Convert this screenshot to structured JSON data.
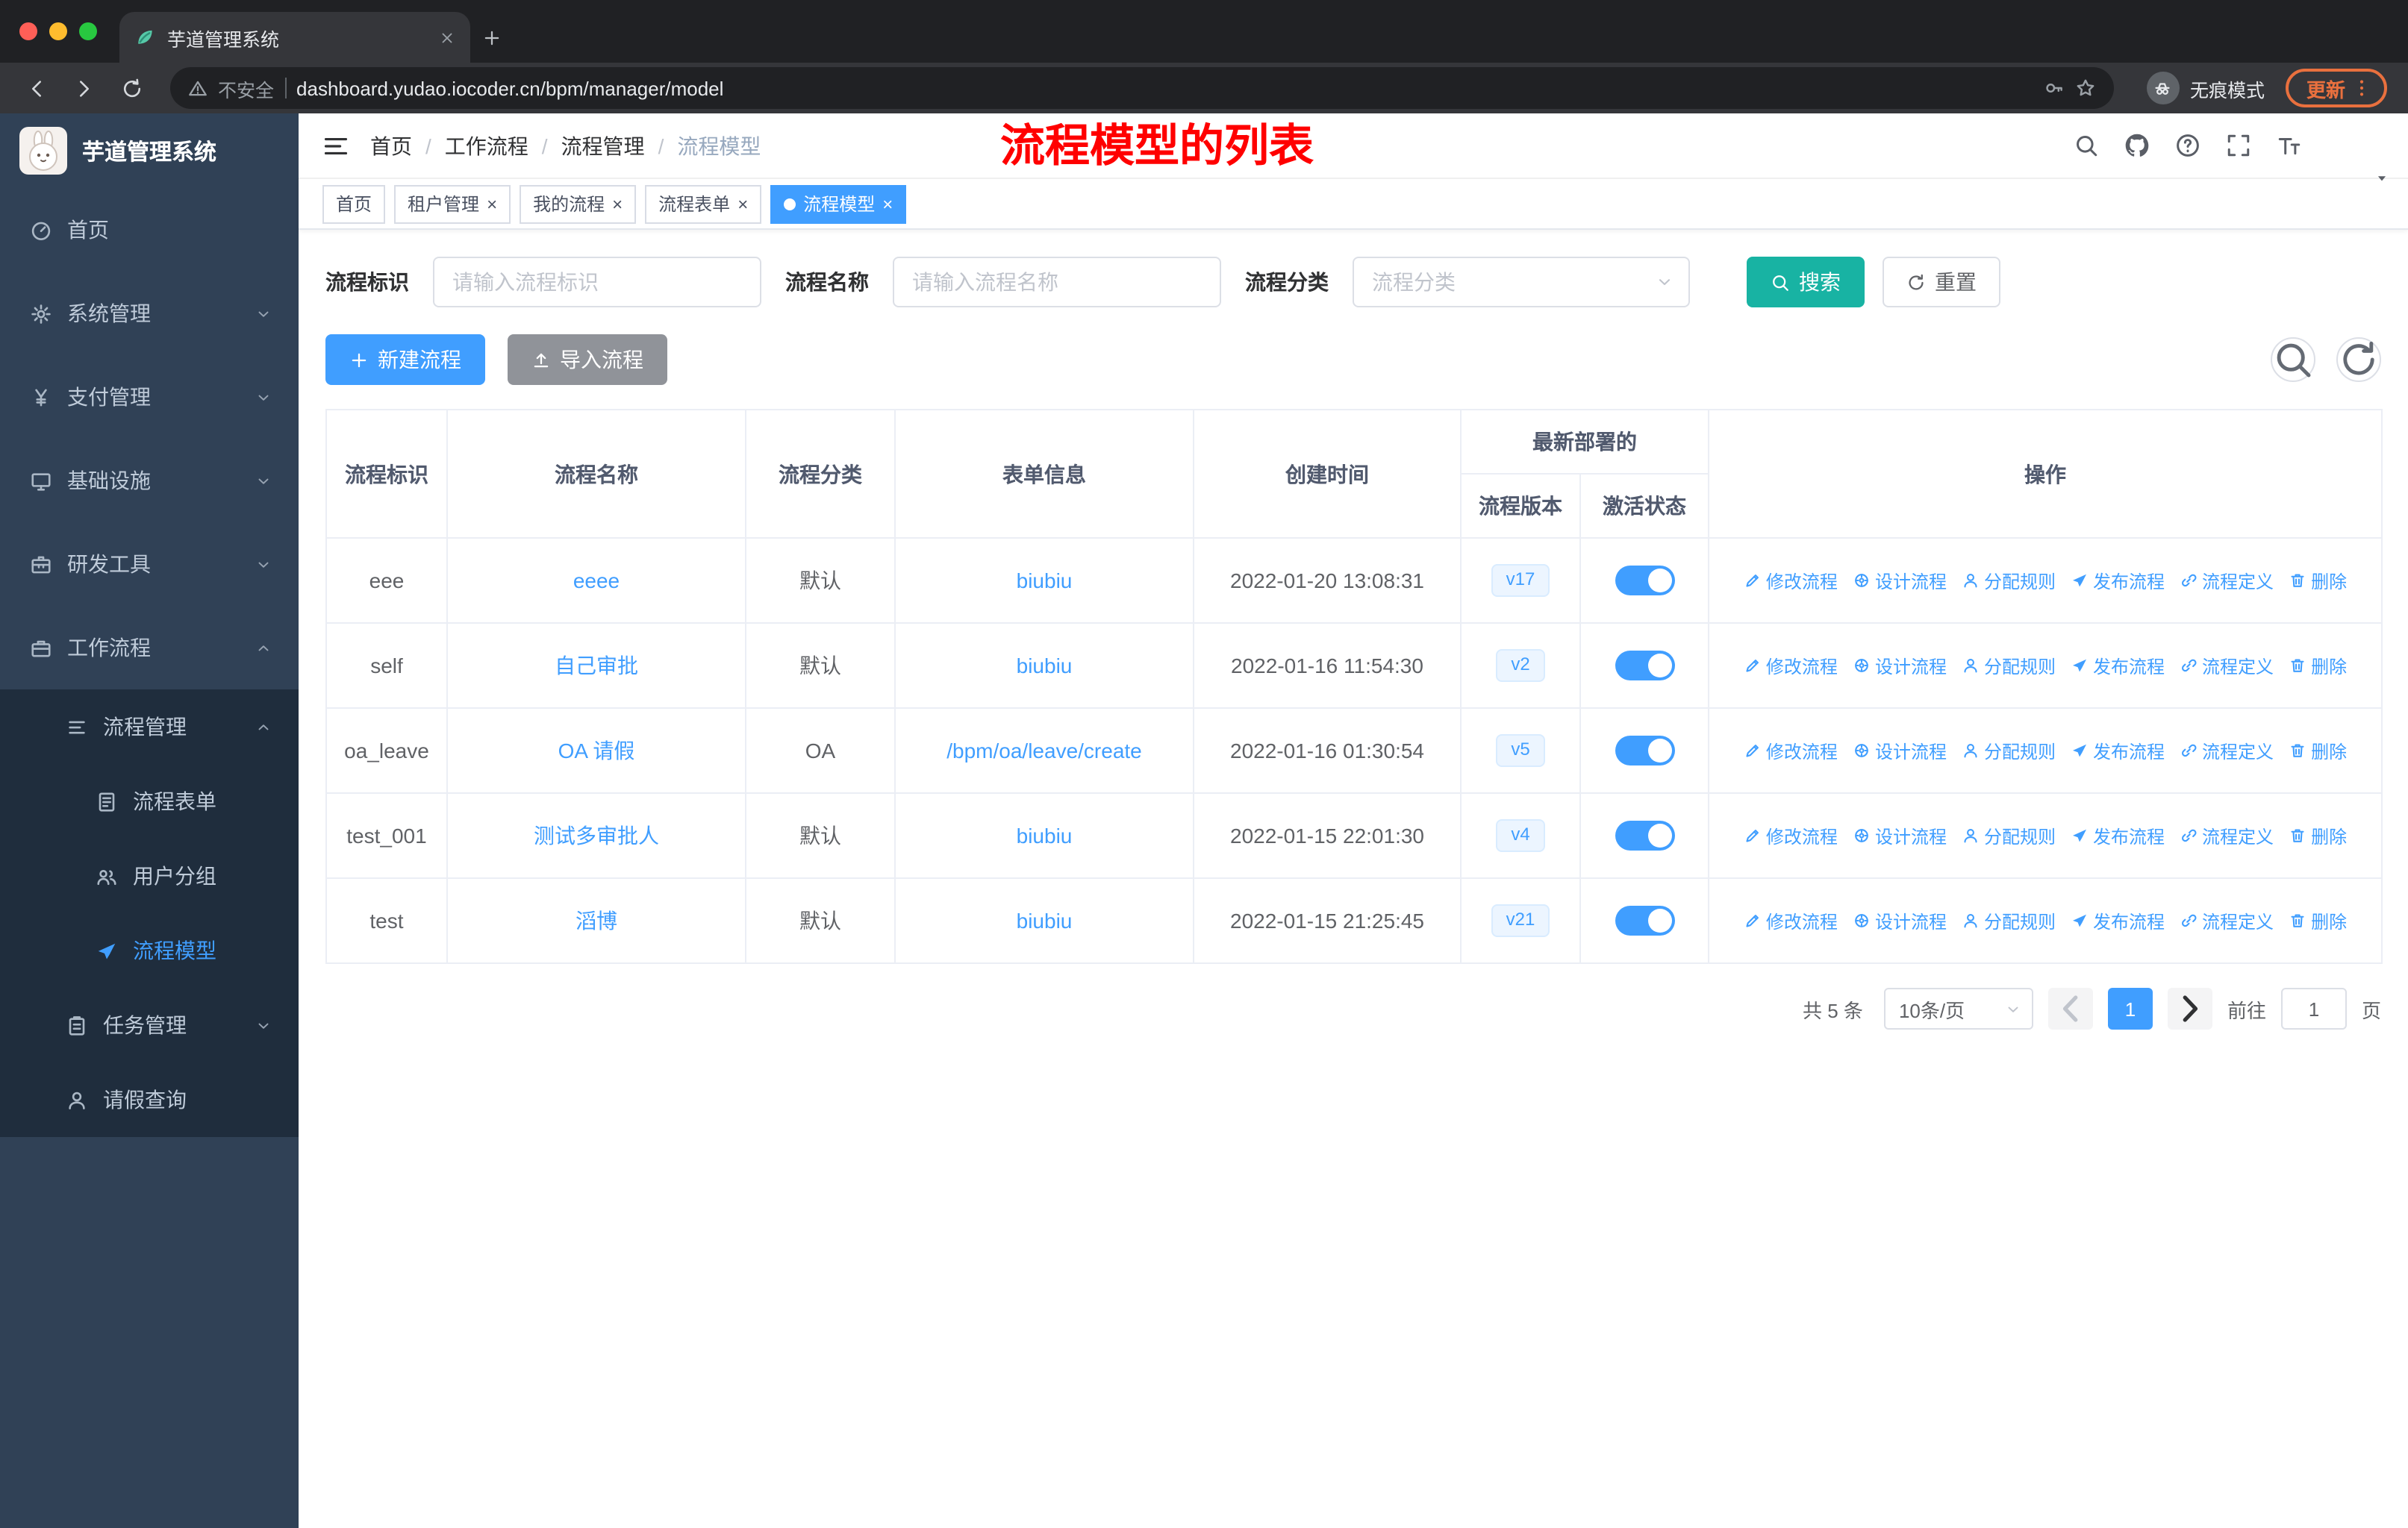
{
  "colors": {
    "accent": "#409eff",
    "search_button": "#18b3a3",
    "annotation_red": "#ff0000",
    "sidebar_bg": "#304156",
    "link": "#409eff"
  },
  "browser": {
    "tab_title": "芋道管理系统",
    "security_label": "不安全",
    "url": "dashboard.yudao.iocoder.cn/bpm/manager/model",
    "incognito_label": "无痕模式",
    "update_label": "更新"
  },
  "sidebar": {
    "logo_title": "芋道管理系统",
    "items": [
      {
        "key": "home",
        "label": "首页",
        "icon": "dashboard-icon",
        "level": 1
      },
      {
        "key": "system",
        "label": "系统管理",
        "icon": "gear-icon",
        "level": 1,
        "chevron": "down"
      },
      {
        "key": "payment",
        "label": "支付管理",
        "icon": "yen-icon",
        "level": 1,
        "chevron": "down"
      },
      {
        "key": "infrastructure",
        "label": "基础设施",
        "icon": "monitor-icon",
        "level": 1,
        "chevron": "down"
      },
      {
        "key": "dev-tools",
        "label": "研发工具",
        "icon": "tool-icon",
        "level": 1,
        "chevron": "down"
      },
      {
        "key": "workflow",
        "label": "工作流程",
        "icon": "briefcase-icon",
        "level": 1,
        "chevron": "up"
      },
      {
        "key": "process-management",
        "label": "流程管理",
        "icon": "flow-icon",
        "level": 2,
        "chevron": "up",
        "in_submenu": true
      },
      {
        "key": "process-form",
        "label": "流程表单",
        "icon": "form-icon",
        "level": 3,
        "in_submenu": true
      },
      {
        "key": "user-group",
        "label": "用户分组",
        "icon": "group-icon",
        "level": 3,
        "in_submenu": true
      },
      {
        "key": "process-model",
        "label": "流程模型",
        "icon": "send-icon",
        "level": 3,
        "in_submenu": true,
        "active": true
      },
      {
        "key": "task-management",
        "label": "任务管理",
        "icon": "task-icon",
        "level": 2,
        "chevron": "down",
        "in_submenu": true
      },
      {
        "key": "leave-query",
        "label": "请假查询",
        "icon": "user-icon",
        "level": 2,
        "in_submenu": true
      }
    ]
  },
  "header": {
    "breadcrumb": [
      "首页",
      "工作流程",
      "流程管理",
      "流程模型"
    ],
    "annotation": "流程模型的列表"
  },
  "tags": [
    {
      "key": "home",
      "label": "首页",
      "closable": false,
      "active": false
    },
    {
      "key": "tenant-management",
      "label": "租户管理",
      "closable": true,
      "active": false
    },
    {
      "key": "my-process",
      "label": "我的流程",
      "closable": true,
      "active": false
    },
    {
      "key": "process-form",
      "label": "流程表单",
      "closable": true,
      "active": false
    },
    {
      "key": "process-model",
      "label": "流程模型",
      "closable": true,
      "active": true
    }
  ],
  "filters": {
    "process_key": {
      "label": "流程标识",
      "placeholder": "请输入流程标识"
    },
    "process_name": {
      "label": "流程名称",
      "placeholder": "请输入流程名称"
    },
    "category": {
      "label": "流程分类",
      "placeholder": "流程分类"
    },
    "search_label": "搜索",
    "reset_label": "重置"
  },
  "toolbar": {
    "create_label": "新建流程",
    "import_label": "导入流程"
  },
  "table": {
    "headers": {
      "key": "流程标识",
      "name": "流程名称",
      "category": "流程分类",
      "form": "表单信息",
      "created": "创建时间",
      "deploy_group": "最新部署的",
      "version": "流程版本",
      "active": "激活状态",
      "actions": "操作"
    },
    "rows": [
      {
        "key": "eee",
        "name": "eeee",
        "category": "默认",
        "form": "biubiu",
        "created": "2022-01-20 13:08:31",
        "version": "v17",
        "active": true
      },
      {
        "key": "self",
        "name": "自己审批",
        "category": "默认",
        "form": "biubiu",
        "created": "2022-01-16 11:54:30",
        "version": "v2",
        "active": true
      },
      {
        "key": "oa_leave",
        "name": "OA 请假",
        "category": "OA",
        "form": "/bpm/oa/leave/create",
        "created": "2022-01-16 01:30:54",
        "version": "v5",
        "active": true
      },
      {
        "key": "test_001",
        "name": "测试多审批人",
        "category": "默认",
        "form": "biubiu",
        "created": "2022-01-15 22:01:30",
        "version": "v4",
        "active": true
      },
      {
        "key": "test",
        "name": "滔博",
        "category": "默认",
        "form": "biubiu",
        "created": "2022-01-15 21:25:45",
        "version": "v21",
        "active": true
      }
    ],
    "actions": [
      {
        "key": "edit",
        "label": "修改流程",
        "icon": "edit-icon"
      },
      {
        "key": "design",
        "label": "设计流程",
        "icon": "design-icon"
      },
      {
        "key": "assign-rule",
        "label": "分配规则",
        "icon": "assign-icon"
      },
      {
        "key": "publish",
        "label": "发布流程",
        "icon": "publish-icon"
      },
      {
        "key": "definition",
        "label": "流程定义",
        "icon": "definition-icon"
      },
      {
        "key": "delete",
        "label": "删除",
        "icon": "delete-icon"
      }
    ]
  },
  "pagination": {
    "total_text": "共 5 条",
    "page_size": "10条/页",
    "current_page": "1",
    "goto_label": "前往",
    "goto_value": "1",
    "page_unit": "页"
  }
}
